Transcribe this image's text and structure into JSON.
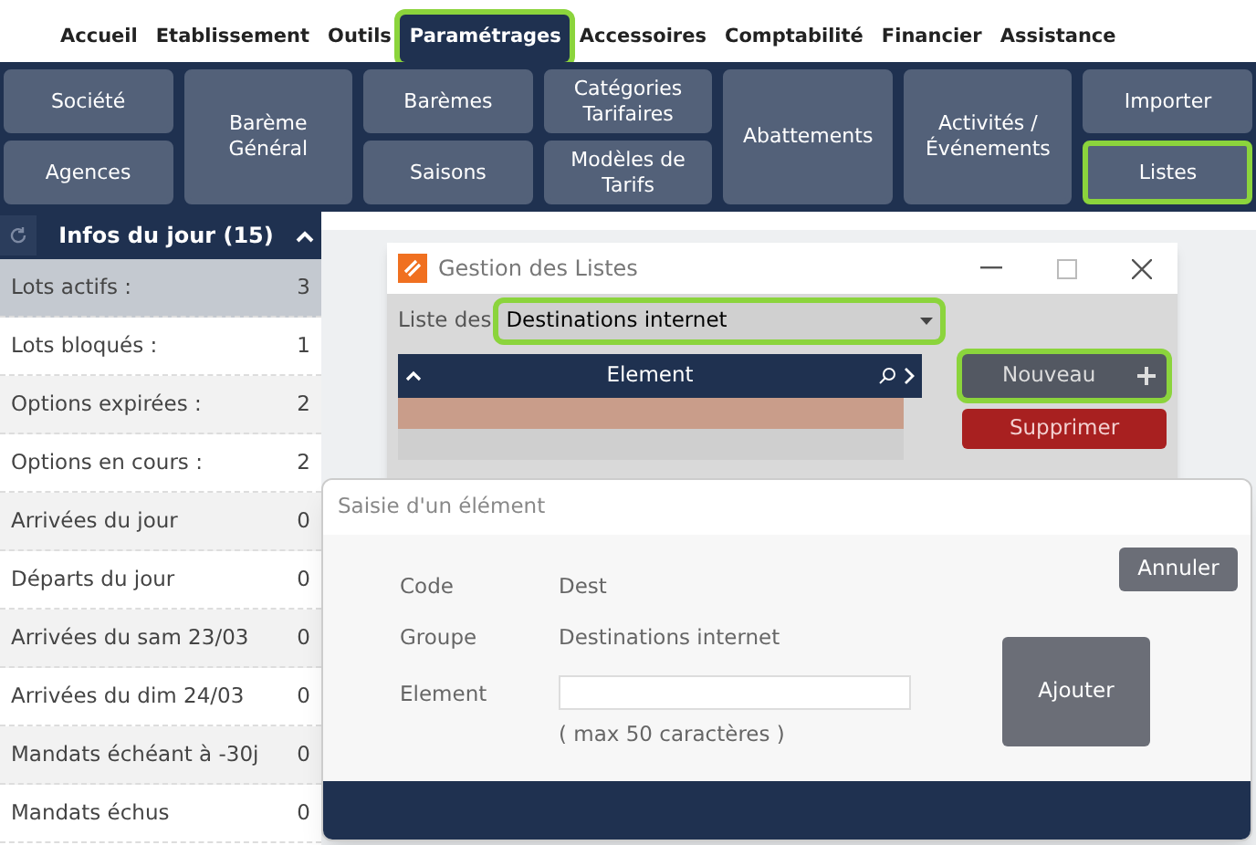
{
  "menu": [
    {
      "label": "Accueil",
      "selected": false,
      "highlighted": false
    },
    {
      "label": "Etablissement",
      "selected": false,
      "highlighted": false
    },
    {
      "label": "Outils",
      "selected": false,
      "highlighted": false
    },
    {
      "label": "Paramétrages",
      "selected": true,
      "highlighted": true
    },
    {
      "label": "Accessoires",
      "selected": false,
      "highlighted": false
    },
    {
      "label": "Comptabilité",
      "selected": false,
      "highlighted": false
    },
    {
      "label": "Financier",
      "selected": false,
      "highlighted": false
    },
    {
      "label": "Assistance",
      "selected": false,
      "highlighted": false
    }
  ],
  "ribbon": [
    {
      "buttons": [
        {
          "label": "Société",
          "highlighted": false
        },
        {
          "label": "Agences",
          "highlighted": false
        }
      ]
    },
    {
      "buttons": [
        {
          "label": "Barème Général",
          "highlighted": false
        }
      ]
    },
    {
      "buttons": [
        {
          "label": "Barèmes",
          "highlighted": false
        },
        {
          "label": "Saisons",
          "highlighted": false
        }
      ]
    },
    {
      "buttons": [
        {
          "label": "Catégories Tarifaires",
          "highlighted": false
        },
        {
          "label": "Modèles de Tarifs",
          "highlighted": false
        }
      ]
    },
    {
      "buttons": [
        {
          "label": "Abattements",
          "highlighted": false
        }
      ]
    },
    {
      "buttons": [
        {
          "label": "Activités / Événements",
          "highlighted": false
        }
      ]
    },
    {
      "buttons": [
        {
          "label": "Importer",
          "highlighted": false
        },
        {
          "label": "Listes",
          "highlighted": true
        }
      ]
    }
  ],
  "infos": {
    "title": "Infos du jour (15)",
    "rows": [
      {
        "label": "Lots actifs :",
        "value": "3",
        "selected": true
      },
      {
        "label": "Lots bloqués :",
        "value": "1",
        "selected": false
      },
      {
        "label": "Options expirées :",
        "value": "2",
        "selected": false
      },
      {
        "label": "Options en cours :",
        "value": "2",
        "selected": false
      },
      {
        "label": "Arrivées du jour",
        "value": "0",
        "selected": false
      },
      {
        "label": "Départs du jour",
        "value": "0",
        "selected": false
      },
      {
        "label": "Arrivées du sam 23/03",
        "value": "0",
        "selected": false
      },
      {
        "label": "Arrivées du dim 24/03",
        "value": "0",
        "selected": false
      },
      {
        "label": "Mandats échéant à -30j",
        "value": "0",
        "selected": false
      },
      {
        "label": "Mandats échus",
        "value": "0",
        "selected": false
      }
    ]
  },
  "lists_window": {
    "title": "Gestion des Listes",
    "list_label": "Liste des",
    "list_value": "Destinations internet",
    "list_highlighted": true,
    "column": "Element",
    "new_button": "Nouveau",
    "new_highlighted": true,
    "delete_button": "Supprimer"
  },
  "entry_dialog": {
    "title": "Saisie d'un élément",
    "fields": [
      {
        "label": "Code",
        "value": "Dest"
      },
      {
        "label": "Groupe",
        "value": "Destinations internet"
      }
    ],
    "element_label": "Element",
    "hint": "( max 50 caractères )",
    "cancel_button": "Annuler",
    "add_button": "Ajouter"
  }
}
